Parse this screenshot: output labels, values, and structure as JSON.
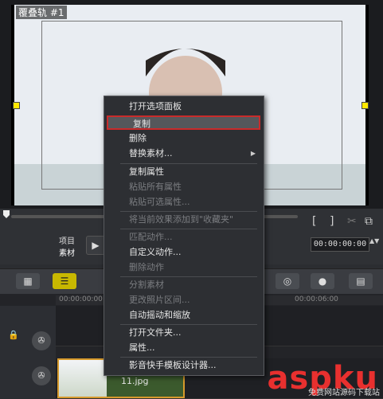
{
  "preview": {
    "overlay_label": "覆叠轨 #1",
    "timecode": "00:00:00:00"
  },
  "controls": {
    "label_project": "项目",
    "label_clip": "素材",
    "play_icon": "play-icon"
  },
  "toolbar": {
    "buttons": [
      "film-storyboard-icon",
      "timeline-view-icon"
    ]
  },
  "timeline": {
    "ruler_ticks": [
      "00:00:00:00",
      "00:00:06:00"
    ],
    "clip_label": "11.jpg"
  },
  "menu": {
    "items": [
      {
        "label": "打开选项面板",
        "enabled": true
      },
      {
        "label": "复制",
        "enabled": true,
        "selected": true
      },
      {
        "label": "删除",
        "enabled": true
      },
      {
        "label": "替换素材...",
        "enabled": true,
        "submenu": true
      },
      {
        "label": "复制属性",
        "enabled": true
      },
      {
        "label": "粘贴所有属性",
        "enabled": false
      },
      {
        "label": "粘贴可选属性...",
        "enabled": false
      },
      {
        "label": "将当前效果添加到\"收藏夹\"",
        "enabled": false
      },
      {
        "label": "匹配动作...",
        "enabled": false
      },
      {
        "label": "自定义动作...",
        "enabled": true
      },
      {
        "label": "删除动作",
        "enabled": false
      },
      {
        "label": "分割素材",
        "enabled": false
      },
      {
        "label": "更改照片区间...",
        "enabled": false
      },
      {
        "label": "自动摇动和缩放",
        "enabled": true
      },
      {
        "label": "打开文件夹...",
        "enabled": true
      },
      {
        "label": "属性...",
        "enabled": true
      },
      {
        "label": "影音快手模板设计器...",
        "enabled": true
      }
    ]
  },
  "watermark": {
    "brand": "aspku",
    "sub": "免费网站源码下载站"
  },
  "colors": {
    "highlight_border": "#c92b2b",
    "accent_yellow": "#ffe800"
  }
}
